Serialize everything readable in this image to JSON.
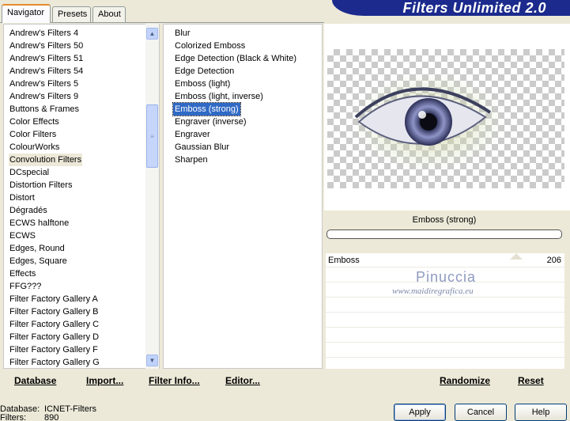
{
  "tabs": [
    "Navigator",
    "Presets",
    "About"
  ],
  "title": "Filters Unlimited 2.0",
  "categories": [
    "Andrew's Filters 4",
    "Andrew's Filters 50",
    "Andrew's Filters 51",
    "Andrew's Filters 54",
    "Andrew's Filters 5",
    "Andrew's Filters 9",
    "Buttons & Frames",
    "Color Effects",
    "Color Filters",
    "ColourWorks",
    "Convolution Filters",
    "DCspecial",
    "Distortion Filters",
    "Distort",
    "Dégradés",
    "ECWS halftone",
    "ECWS",
    "Edges, Round",
    "Edges, Square",
    "Effects",
    "FFG???",
    "Filter Factory Gallery A",
    "Filter Factory Gallery B",
    "Filter Factory Gallery C",
    "Filter Factory Gallery D",
    "Filter Factory Gallery F",
    "Filter Factory Gallery G"
  ],
  "selected_category": "Convolution Filters",
  "filters": [
    "Blur",
    "Colorized Emboss",
    "Edge Detection (Black & White)",
    "Edge Detection",
    "Emboss (light)",
    "Emboss (light, inverse)",
    "Emboss (strong)",
    "Engraver (inverse)",
    "Engraver",
    "Gaussian Blur",
    "Sharpen"
  ],
  "selected_filter": "Emboss (strong)",
  "preview": {
    "filter_name": "Emboss (strong)"
  },
  "sliders": [
    {
      "label": "Emboss",
      "value": "206"
    }
  ],
  "watermark": {
    "name": "Pinuccia",
    "url": "www.maidiregrafica.eu"
  },
  "toolbar": {
    "database": "Database",
    "import": "Import...",
    "filter_info": "Filter Info...",
    "editor": "Editor...",
    "randomize": "Randomize",
    "reset": "Reset"
  },
  "status": {
    "database_label": "Database:",
    "database_value": "ICNET-Filters",
    "filters_label": "Filters:",
    "filters_value": "890"
  },
  "buttons": {
    "apply": "Apply",
    "cancel": "Cancel",
    "help": "Help"
  },
  "colors": {
    "selection": "#316ac5",
    "banner": "#1b2a8c",
    "accent_tab": "#e68b2c"
  }
}
